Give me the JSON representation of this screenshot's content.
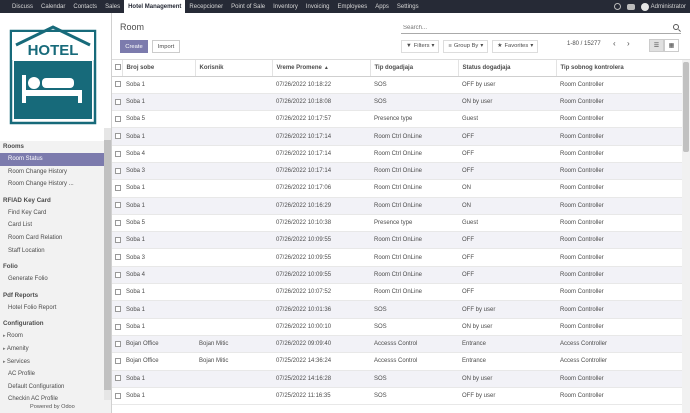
{
  "topbar": {
    "menu": [
      "Discuss",
      "Calendar",
      "Contacts",
      "Sales",
      "Hotel Management",
      "Recepcioner",
      "Point of Sale",
      "Inventory",
      "Invoicing",
      "Employees",
      "Apps",
      "Settings"
    ],
    "active_index": 4,
    "user": "Administrator"
  },
  "sidebar": {
    "logo_text": "HOTEL",
    "sections": [
      {
        "title": "Rooms",
        "items": [
          {
            "label": "Room Status",
            "active": true,
            "caret": false
          },
          {
            "label": "Room Change History",
            "active": false,
            "caret": false
          },
          {
            "label": "Room Change History ...",
            "active": false,
            "caret": false
          }
        ]
      },
      {
        "title": "RFIAD Key Card",
        "items": [
          {
            "label": "Find Key Card",
            "active": false,
            "caret": false
          },
          {
            "label": "Card List",
            "active": false,
            "caret": false
          },
          {
            "label": "Room Card Relation",
            "active": false,
            "caret": false
          },
          {
            "label": "Staff Location",
            "active": false,
            "caret": false
          }
        ]
      },
      {
        "title": "Folio",
        "items": [
          {
            "label": "Generate Folio",
            "active": false,
            "caret": false
          }
        ]
      },
      {
        "title": "Pdf Reports",
        "items": [
          {
            "label": "Hotel Folio Report",
            "active": false,
            "caret": false
          }
        ]
      },
      {
        "title": "Configuration",
        "items": [
          {
            "label": "Room",
            "active": false,
            "caret": true
          },
          {
            "label": "Amenity",
            "active": false,
            "caret": true
          },
          {
            "label": "Services",
            "active": false,
            "caret": true
          },
          {
            "label": "AC Profile",
            "active": false,
            "caret": false
          },
          {
            "label": "Default Configuration",
            "active": false,
            "caret": false
          },
          {
            "label": "Checkin AC Profile",
            "active": false,
            "caret": false
          }
        ]
      }
    ],
    "powered_by": "Powered by Odoo"
  },
  "control": {
    "title": "Room",
    "search_placeholder": "Search...",
    "create_label": "Create",
    "import_label": "Import",
    "filters_label": "Filters",
    "group_by_label": "Group By",
    "favorites_label": "Favorites",
    "pager": "1-80 / 15277"
  },
  "table": {
    "headers": [
      "Broj sobe",
      "Korisnik",
      "Vreme Promene",
      "Tip dogadjaja",
      "Status dogadjaja",
      "Tip sobnog kontrolera"
    ],
    "rows": [
      [
        "Soba 1",
        "",
        "07/26/2022 10:18:22",
        "SOS",
        "OFF by user",
        "Room Controller"
      ],
      [
        "Soba 1",
        "",
        "07/26/2022 10:18:08",
        "SOS",
        "ON by user",
        "Room Controller"
      ],
      [
        "Soba 5",
        "",
        "07/26/2022 10:17:57",
        "Presence type",
        "Guest",
        "Room Controller"
      ],
      [
        "Soba 1",
        "",
        "07/26/2022 10:17:14",
        "Room Ctrl OnLine",
        "OFF",
        "Room Controller"
      ],
      [
        "Soba 4",
        "",
        "07/26/2022 10:17:14",
        "Room Ctrl OnLine",
        "OFF",
        "Room Controller"
      ],
      [
        "Soba 3",
        "",
        "07/26/2022 10:17:14",
        "Room Ctrl OnLine",
        "OFF",
        "Room Controller"
      ],
      [
        "Soba 1",
        "",
        "07/26/2022 10:17:06",
        "Room Ctrl OnLine",
        "ON",
        "Room Controller"
      ],
      [
        "Soba 1",
        "",
        "07/26/2022 10:16:29",
        "Room Ctrl OnLine",
        "ON",
        "Room Controller"
      ],
      [
        "Soba 5",
        "",
        "07/26/2022 10:10:38",
        "Presence type",
        "Guest",
        "Room Controller"
      ],
      [
        "Soba 1",
        "",
        "07/26/2022 10:09:55",
        "Room Ctrl OnLine",
        "OFF",
        "Room Controller"
      ],
      [
        "Soba 3",
        "",
        "07/26/2022 10:09:55",
        "Room Ctrl OnLine",
        "OFF",
        "Room Controller"
      ],
      [
        "Soba 4",
        "",
        "07/26/2022 10:09:55",
        "Room Ctrl OnLine",
        "OFF",
        "Room Controller"
      ],
      [
        "Soba 1",
        "",
        "07/26/2022 10:07:52",
        "Room Ctrl OnLine",
        "OFF",
        "Room Controller"
      ],
      [
        "Soba 1",
        "",
        "07/26/2022 10:01:36",
        "SOS",
        "OFF by user",
        "Room Controller"
      ],
      [
        "Soba 1",
        "",
        "07/26/2022 10:00:10",
        "SOS",
        "ON by user",
        "Room Controller"
      ],
      [
        "Bojan Office",
        "Bojan Mitic",
        "07/26/2022 09:09:40",
        "Accesss Control",
        "Entrance",
        "Access Controller"
      ],
      [
        "Bojan Office",
        "Bojan Mitic",
        "07/25/2022 14:36:24",
        "Accesss Control",
        "Entrance",
        "Access Controller"
      ],
      [
        "Soba 1",
        "",
        "07/25/2022 14:16:28",
        "SOS",
        "ON by user",
        "Room Controller"
      ],
      [
        "Soba 1",
        "",
        "07/25/2022 11:16:35",
        "SOS",
        "OFF by user",
        "Room Controller"
      ]
    ]
  },
  "colors": {
    "topbar": "#262a36",
    "accent": "#7c7bad",
    "logo_teal": "#176a7a"
  }
}
